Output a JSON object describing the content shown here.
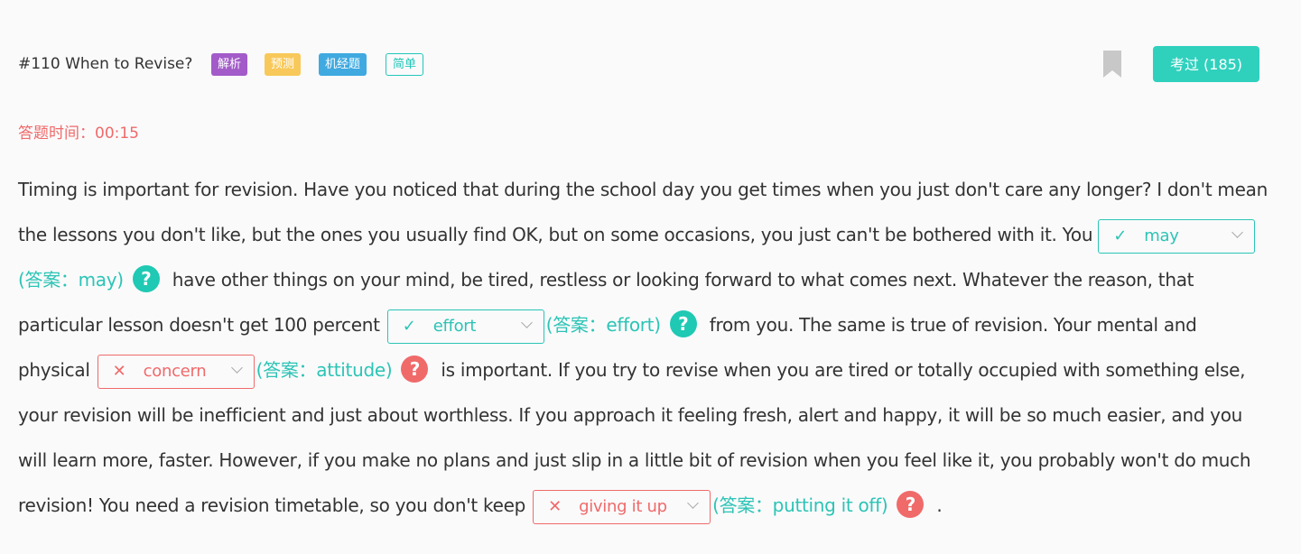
{
  "question": {
    "title": "#110 When to Revise?",
    "tags": [
      "解析",
      "预测",
      "机经题",
      "简单"
    ],
    "exam_button": "考过 (185)"
  },
  "timer": {
    "label": "答题时间：",
    "value": "00:15"
  },
  "passage": {
    "seg1": "Timing is important for revision. Have you noticed that during the school day you get times when you just don't care any longer? I don't mean the lessons you don't like, but the ones you usually find OK, but on some occasions, you just can't be bothered with it. You",
    "seg2": "have other things on your mind, be tired, restless or looking forward to what comes next. Whatever the reason, that particular lesson doesn't get 100 percent",
    "seg3": "from you. The same is true of revision. Your mental and physical",
    "seg4": "is important. If you try to revise when you are tired or totally occupied with something else, your revision will be inefficient and just about worthless. If you approach it feeling fresh, alert and happy, it will be so much easier, and you will learn more, faster. However, if you make no plans and just slip in a little bit of revision when you feel like it, you probably won't do much revision! You need a revision timetable, so you don't keep",
    "seg5": "."
  },
  "blanks": [
    {
      "value": "may",
      "status": "correct",
      "mark": "✓",
      "answer": "(答案：may)",
      "help": "?"
    },
    {
      "value": "effort",
      "status": "correct",
      "mark": "✓",
      "answer": "(答案：effort)",
      "help": "?"
    },
    {
      "value": "concern",
      "status": "wrong",
      "mark": "✕",
      "answer": "(答案：attitude)",
      "help": "?"
    },
    {
      "value": "giving it up",
      "status": "wrong",
      "mark": "✕",
      "answer": "(答案：putting it off)",
      "help": "?"
    }
  ],
  "colors": {
    "accent": "#2fd1bd",
    "correct": "#2cc4b5",
    "wrong": "#f06a6a",
    "tag_purple": "#a25bc8",
    "tag_yellow": "#f8c95a",
    "tag_blue": "#3fa9e0"
  },
  "icons": {
    "bookmark": "bookmark-icon",
    "help": "question-circle-icon",
    "dropdown": "chevron-down-icon"
  }
}
